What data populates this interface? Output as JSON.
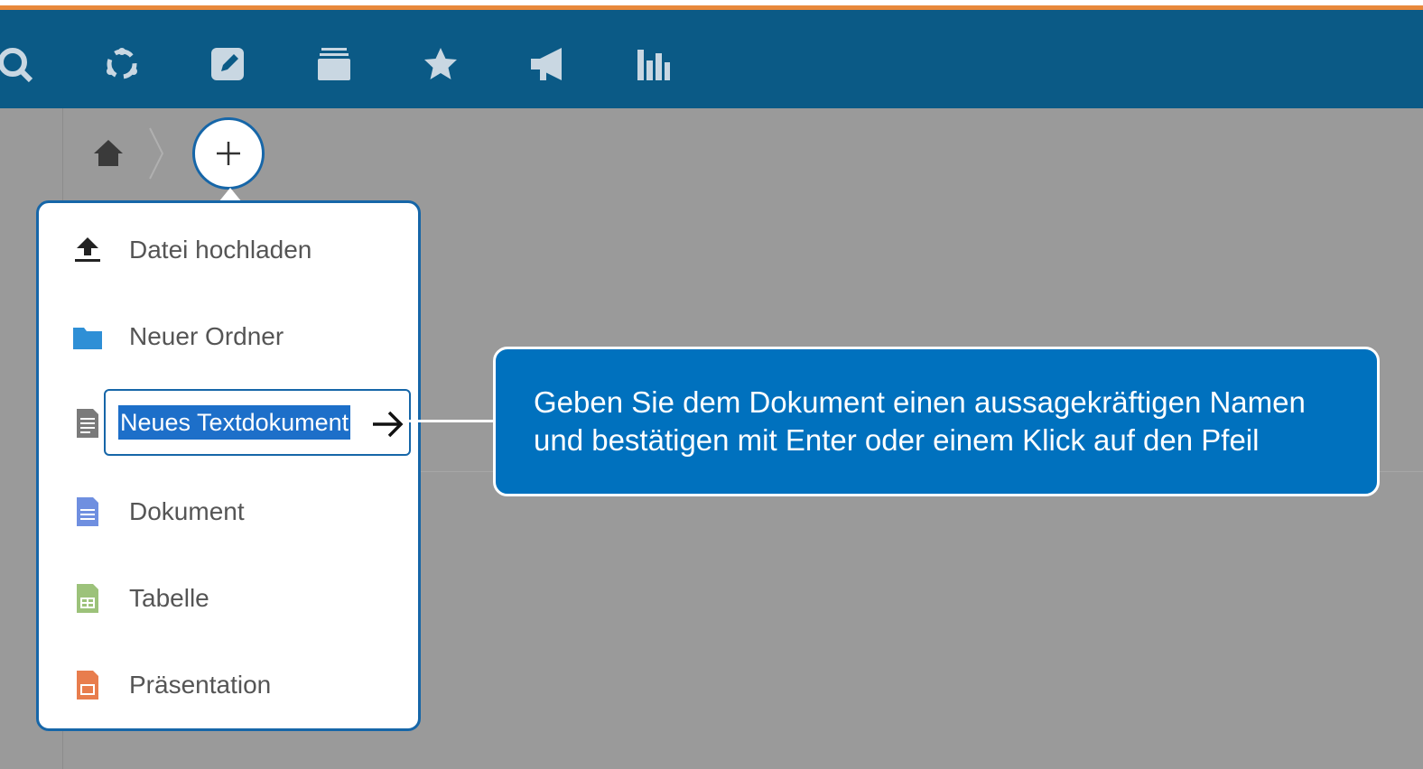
{
  "header": {
    "icons": [
      "search-icon",
      "sync-icon",
      "edit-icon",
      "stack-icon",
      "star-icon",
      "megaphone-icon",
      "bar-chart-icon"
    ],
    "bg_color": "#0b5a86",
    "accent_color": "#e8883a"
  },
  "breadcrumb": {
    "home_icon": "home-icon",
    "add_button_symbol": "+"
  },
  "menu": {
    "items": [
      {
        "label": "Datei hochladen",
        "icon": "upload-icon"
      },
      {
        "label": "Neuer Ordner",
        "icon": "folder-icon"
      },
      {
        "label": "Neues Textdokument",
        "icon": "text-file-icon",
        "editing": true
      },
      {
        "label": "Dokument",
        "icon": "document-icon"
      },
      {
        "label": "Tabelle",
        "icon": "spreadsheet-icon"
      },
      {
        "label": "Präsentation",
        "icon": "presentation-icon"
      }
    ]
  },
  "callout": {
    "line1": "Geben Sie dem Dokument einen aussagekräftigen Namen",
    "line2": "und bestätigen mit Enter oder einem Klick auf den Pfeil",
    "color": "#0071be"
  }
}
